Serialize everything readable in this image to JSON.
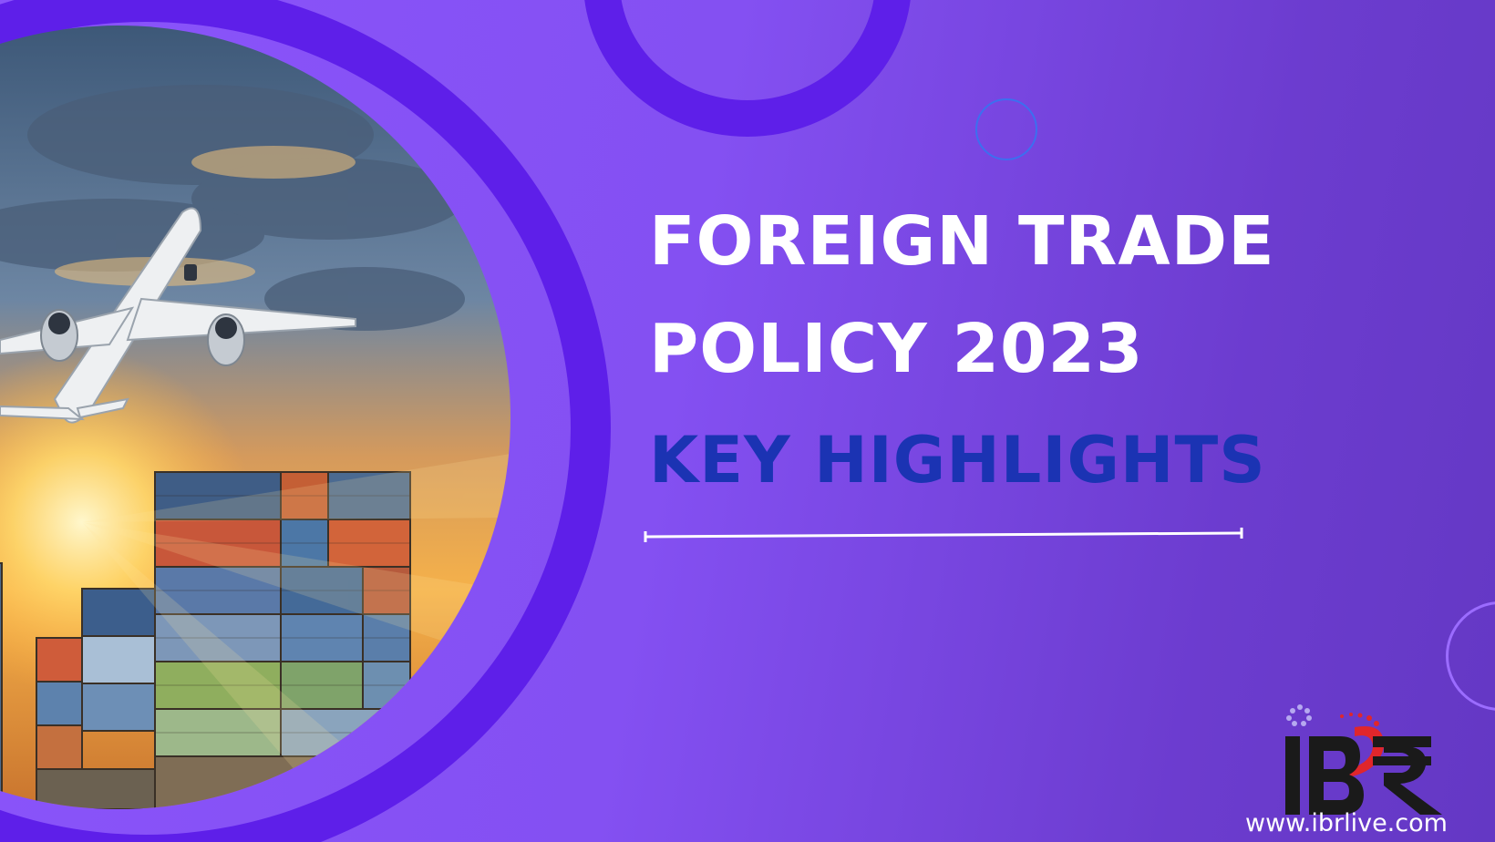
{
  "title": {
    "line1": "FOREIGN TRADE",
    "line2": "POLICY 2023"
  },
  "subtitle": "KEY HIGHLIGHTS",
  "logo": {
    "text": "IBR",
    "url": "www.ibrlive.com"
  },
  "colors": {
    "background": "#8450f2",
    "ring": "#5e1fe9",
    "title": "#ffffff",
    "subtitle": "#1b33b3",
    "logo_red": "#e0262b"
  },
  "photo": {
    "subject": "airplane taking off over stacked shipping containers at sunset"
  }
}
